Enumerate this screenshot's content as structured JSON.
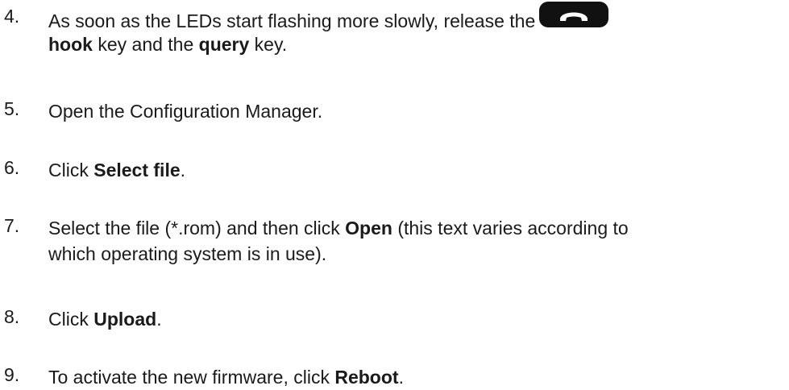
{
  "steps": [
    {
      "number": "4.",
      "line1_pre": "As soon as the LEDs start flashing more slowly, release the",
      "icon": "hook-key-icon",
      "line2_bold1": "hook",
      "line2_mid": " key and the ",
      "line2_bold2": "query",
      "line2_post": " key."
    },
    {
      "number": "5.",
      "text": "Open the Configuration Manager."
    },
    {
      "number": "6.",
      "pre": "Click ",
      "bold": "Select file",
      "post": "."
    },
    {
      "number": "7.",
      "line1_pre": "Select the file (*.rom) and then click ",
      "line1_bold": "Open",
      "line1_post": " (this text varies according to",
      "line2": "which operating system is in use)."
    },
    {
      "number": "8.",
      "pre": "Click ",
      "bold": "Upload",
      "post": "."
    },
    {
      "number": "9.",
      "pre": "To activate the new firmware, click ",
      "bold": "Reboot",
      "post": "."
    }
  ]
}
